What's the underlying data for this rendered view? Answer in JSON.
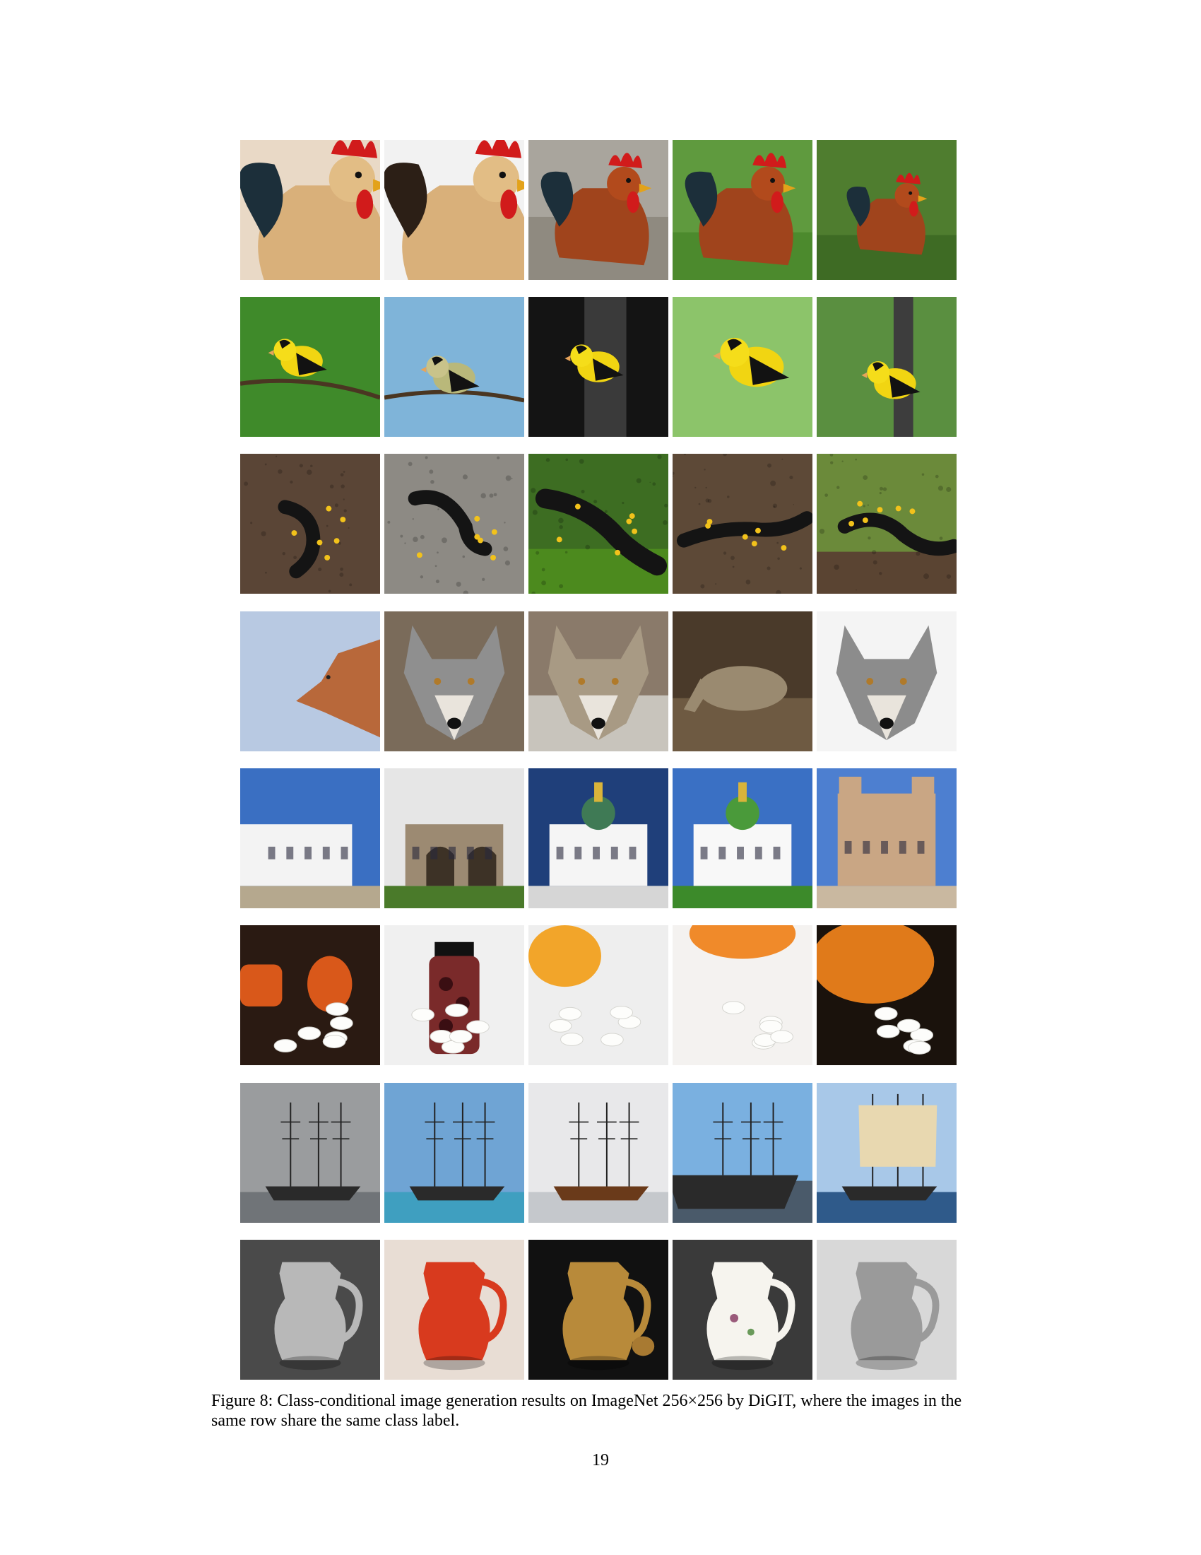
{
  "figure": {
    "label": "Figure 8:",
    "caption_text": "Class-conditional image generation results on ImageNet 256×256 by DiGIT, where the images in the same row share the same class label.",
    "rows": [
      {
        "subject": "rooster",
        "images": [
          "rooster",
          "rooster",
          "rooster",
          "rooster",
          "rooster"
        ]
      },
      {
        "subject": "goldfinch",
        "images": [
          "goldfinch",
          "goldfinch",
          "goldfinch",
          "goldfinch",
          "goldfinch"
        ]
      },
      {
        "subject": "fire salamander",
        "images": [
          "fire salamander",
          "fire salamander",
          "fire salamander",
          "fire salamander",
          "fire salamander"
        ]
      },
      {
        "subject": "wolf",
        "images": [
          "wolf",
          "wolf",
          "wolf",
          "wolf",
          "wolf"
        ]
      },
      {
        "subject": "church",
        "images": [
          "church",
          "church",
          "church",
          "church",
          "church"
        ]
      },
      {
        "subject": "pill bottle",
        "images": [
          "pill bottle",
          "pill bottle",
          "pill bottle",
          "pill bottle",
          "pill bottle"
        ]
      },
      {
        "subject": "schooner",
        "images": [
          "schooner",
          "schooner",
          "schooner",
          "schooner",
          "schooner"
        ]
      },
      {
        "subject": "pitcher",
        "images": [
          "pitcher",
          "pitcher",
          "pitcher",
          "pitcher",
          "pitcher"
        ]
      }
    ]
  },
  "page_number": "19"
}
